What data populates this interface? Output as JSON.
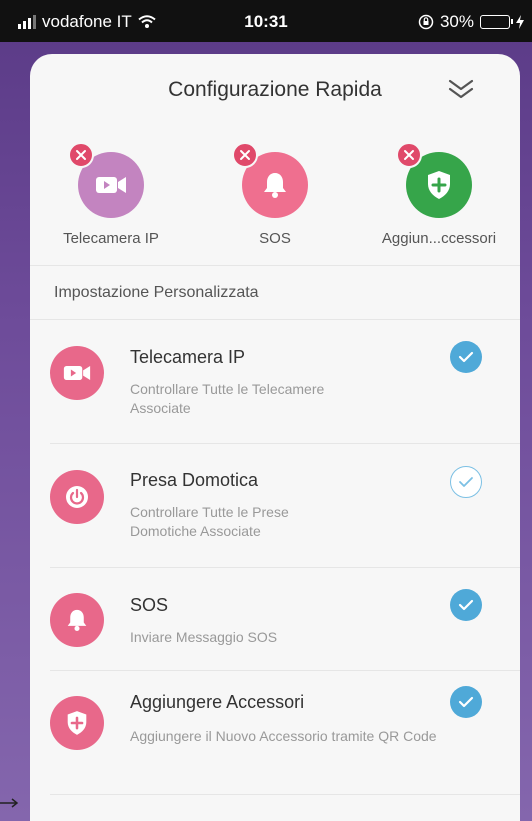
{
  "status_bar": {
    "carrier": "vodafone IT",
    "time": "10:31",
    "battery": "30%"
  },
  "sheet": {
    "title": "Configurazione Rapida"
  },
  "quick_items": [
    {
      "label": "Telecamera IP",
      "icon": "camera-icon",
      "color": "#c384c0"
    },
    {
      "label": "SOS",
      "icon": "bell-icon",
      "color": "#ef6f8f"
    },
    {
      "label": "Aggiun...ccessori",
      "icon": "shield-plus-icon",
      "color": "#36a54a"
    }
  ],
  "section": {
    "title": "Impostazione Personalizzata"
  },
  "list": [
    {
      "title": "Telecamera IP",
      "desc": "Controllare Tutte le Telecamere Associate",
      "icon": "camera-icon",
      "checked": true
    },
    {
      "title": "Presa Domotica",
      "desc": "Controllare Tutte le Prese Domotiche Associate",
      "icon": "power-icon",
      "checked": false
    },
    {
      "title": "SOS",
      "desc": "Inviare Messaggio SOS",
      "icon": "bell-icon",
      "checked": true
    },
    {
      "title": "Aggiungere Accessori",
      "desc": "Aggiungere il Nuovo Accessorio tramite QR Code",
      "icon": "shield-plus-icon",
      "checked": true
    }
  ],
  "colors": {
    "accent_pink": "#e8688a",
    "check_blue": "#4fa9d8",
    "remove_red": "#e0496a"
  }
}
